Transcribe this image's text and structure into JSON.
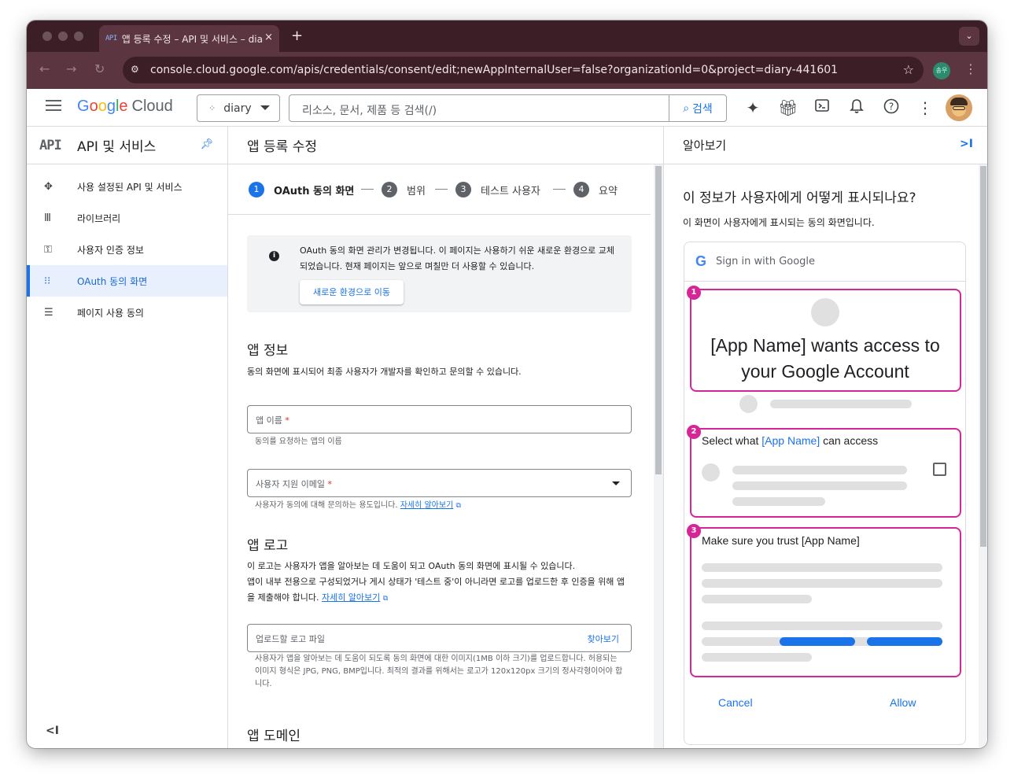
{
  "browser": {
    "tab_favicon": "API",
    "tab_title": "앱 등록 수정 – API 및 서비스 – diary",
    "tab_close": "×",
    "new_tab": "+",
    "url": "console.cloud.google.com/apis/credentials/consent/edit;newAppInternalUser=false?organizationId=0&project=diary-441601",
    "profile_label": "송우"
  },
  "header": {
    "logo_letters": [
      "G",
      "o",
      "o",
      "g",
      "l",
      "e"
    ],
    "logo_suffix": "Cloud",
    "project": "diary",
    "search_placeholder": "리소스, 문서, 제품 등 검색(/)",
    "search_button": "검색",
    "icons": [
      "gemini-icon",
      "gift-icon",
      "cloud-shell-icon",
      "notifications-icon",
      "help-icon",
      "more-icon"
    ]
  },
  "sidebar": {
    "badge": "API",
    "title": "API 및 서비스",
    "items": [
      {
        "icon": "✥",
        "label": "사용 설정된 API 및 서비스",
        "active": false
      },
      {
        "icon": "Ⅲ",
        "label": "라이브러리",
        "active": false
      },
      {
        "icon": "⚿",
        "label": "사용자 인증 정보",
        "active": false
      },
      {
        "icon": "⁝⁝",
        "label": "OAuth 동의 화면",
        "active": true
      },
      {
        "icon": "☰",
        "label": "페이지 사용 동의",
        "active": false
      }
    ],
    "collapse": "<I"
  },
  "main": {
    "title": "앱 등록 수정",
    "steps": [
      {
        "num": "1",
        "label": "OAuth 동의 화면"
      },
      {
        "num": "2",
        "label": "범위"
      },
      {
        "num": "3",
        "label": "테스트 사용자"
      },
      {
        "num": "4",
        "label": "요약"
      }
    ],
    "notice": {
      "text": "OAuth 동의 화면 관리가 변경됩니다. 이 페이지는 사용하기 쉬운 새로운 환경으로 교체되었습니다. 현재 페이지는 앞으로 며칠만 더 사용할 수 있습니다.",
      "button": "새로운 환경으로 이동"
    },
    "app_info": {
      "heading": "앱 정보",
      "desc": "동의 화면에 표시되어 최종 사용자가 개발자를 확인하고 문의할 수 있습니다.",
      "app_name_label": "앱 이름",
      "app_name_hint": "동의를 요청하는 앱의 이름",
      "email_label": "사용자 지원 이메일",
      "email_hint": "사용자가 동의에 대해 문의하는 용도입니다.",
      "learn_more": "자세히 알아보기"
    },
    "app_logo": {
      "heading": "앱 로고",
      "desc1": "이 로고는 사용자가 앱을 알아보는 데 도움이 되고 OAuth 동의 화면에 표시될 수 있습니다.",
      "desc2": "앱이 내부 전용으로 구성되었거나 게시 상태가 '테스트 중'이 아니라면 로고를 업로드한 후 인증을 위해 앱을 제출해야 합니다.",
      "learn_more": "자세히 알아보기",
      "upload_label": "업로드할 로고 파일",
      "browse": "찾아보기",
      "hint": "사용자가 앱을 알아보는 데 도움이 되도록 동의 화면에 대한 이미지(1MB 이하 크기)를 업로드합니다. 허용되는 이미지 형식은 JPG, PNG, BMP입니다. 최적의 결과를 위해서는 로고가 120x120px 크기의 정사각형이어야 합니다."
    },
    "app_domain": {
      "heading": "앱 도메인"
    }
  },
  "panel": {
    "title": "알아보기",
    "close": ">I",
    "question": "이 정보가 사용자에게 어떻게 표시되나요?",
    "subtitle": "이 화면이 사용자에게 표시되는 동의 화면입니다.",
    "mock": {
      "header": "Sign in with Google",
      "box1_text": "[App Name] wants access to your Google Account",
      "box2_prefix": "Select what ",
      "box2_app": "[App Name]",
      "box2_suffix": " can access",
      "box3_text": "Make sure you trust [App Name]",
      "cancel": "Cancel",
      "allow": "Allow",
      "highlight_color": "#d62596"
    }
  }
}
